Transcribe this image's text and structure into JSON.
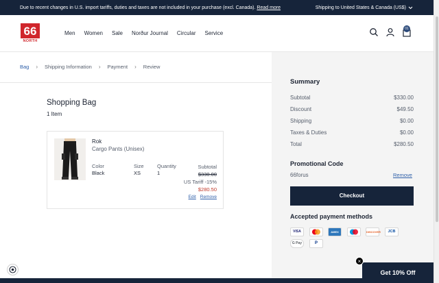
{
  "announcement": {
    "text": "Due to recent changes in U.S. import tariffs, duties and taxes are not included in your purchase (excl. Canada).",
    "link": "Read more",
    "shipping": "Shipping to United States & Canada (US$)"
  },
  "brand": {
    "logo_text": "66",
    "logo_sub": "NORTH"
  },
  "nav": [
    "Men",
    "Women",
    "Sale",
    "Norður Journal",
    "Circular",
    "Service"
  ],
  "header": {
    "bag_count": "01"
  },
  "breadcrumb": [
    "Bag",
    "Shipping Information",
    "Payment",
    "Review"
  ],
  "bag": {
    "title": "Shopping Bag",
    "count": "1 Item"
  },
  "item": {
    "name": "Rok",
    "subtitle": "Cargo Pants (Unisex)",
    "color_label": "Color",
    "color_value": "Black",
    "size_label": "Size",
    "size_value": "XS",
    "qty_label": "Quantity",
    "qty_value": "1",
    "subtotal_label": "Subtotal",
    "original_price": "$330.00",
    "tariff": "US Tariff -15%",
    "final_price": "$280.50",
    "edit": "Edit",
    "remove": "Remove"
  },
  "summary": {
    "title": "Summary",
    "rows": [
      {
        "label": "Subtotal",
        "value": "$330.00"
      },
      {
        "label": "Discount",
        "value": "$49.50"
      },
      {
        "label": "Shipping",
        "value": "$0.00"
      },
      {
        "label": "Taxes & Duties",
        "value": "$0.00"
      },
      {
        "label": "Total",
        "value": "$280.50"
      }
    ],
    "promo_title": "Promotional Code",
    "promo_code": "66forus",
    "promo_remove": "Remove",
    "checkout": "Checkout",
    "payment_title": "Accepted payment methods",
    "payment_methods": [
      "VISA",
      "Mastercard",
      "American Express",
      "Maestro",
      "Discover",
      "JCB",
      "G Pay",
      "PayPal"
    ]
  },
  "popup": {
    "label": "Get 10% Off",
    "close": "×"
  },
  "colors": {
    "navy": "#16243a",
    "sale_red": "#c0392b",
    "link_blue": "#2d5ea8",
    "brand_red": "#d0262c"
  }
}
